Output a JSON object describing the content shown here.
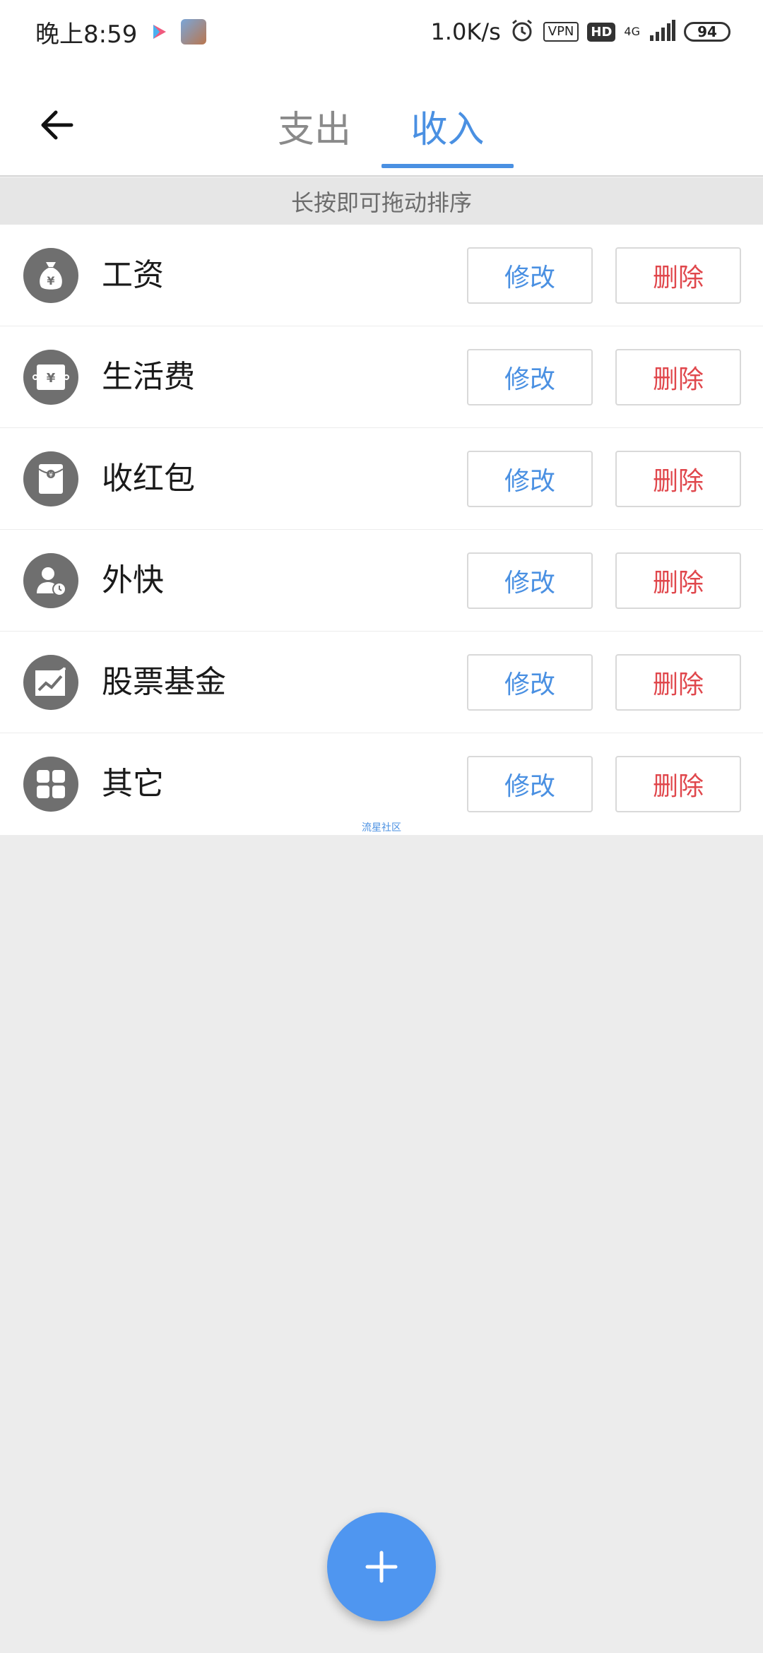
{
  "status_bar": {
    "time": "晚上8:59",
    "net_speed": "1.0K/s",
    "vpn": "VPN",
    "hd": "HD",
    "network": "4G",
    "battery": "94",
    "icons": [
      "video-app-icon",
      "avatar-app-icon",
      "alarm-icon",
      "signal-icon",
      "battery-icon"
    ]
  },
  "header": {
    "back_icon": "arrow-left-icon",
    "tabs": [
      {
        "label": "支出",
        "active": false
      },
      {
        "label": "收入",
        "active": true
      }
    ]
  },
  "hint": "长按即可拖动排序",
  "categories": [
    {
      "label": "工资",
      "icon": "money-bag-icon",
      "edit": "修改",
      "delete": "删除"
    },
    {
      "label": "生活费",
      "icon": "banknote-icon",
      "edit": "修改",
      "delete": "删除"
    },
    {
      "label": "收红包",
      "icon": "red-packet-icon",
      "edit": "修改",
      "delete": "删除"
    },
    {
      "label": "外快",
      "icon": "person-clock-icon",
      "edit": "修改",
      "delete": "删除"
    },
    {
      "label": "股票基金",
      "icon": "stock-chart-icon",
      "edit": "修改",
      "delete": "删除"
    },
    {
      "label": "其它",
      "icon": "grid-icon",
      "edit": "修改",
      "delete": "删除"
    }
  ],
  "watermark": "流星社区",
  "fab": {
    "icon": "plus-icon"
  },
  "colors": {
    "accent": "#4a90e2",
    "danger": "#e0474c",
    "icon_bg": "#6f6f6f",
    "background": "#ececec",
    "fab": "#4f96f0"
  }
}
